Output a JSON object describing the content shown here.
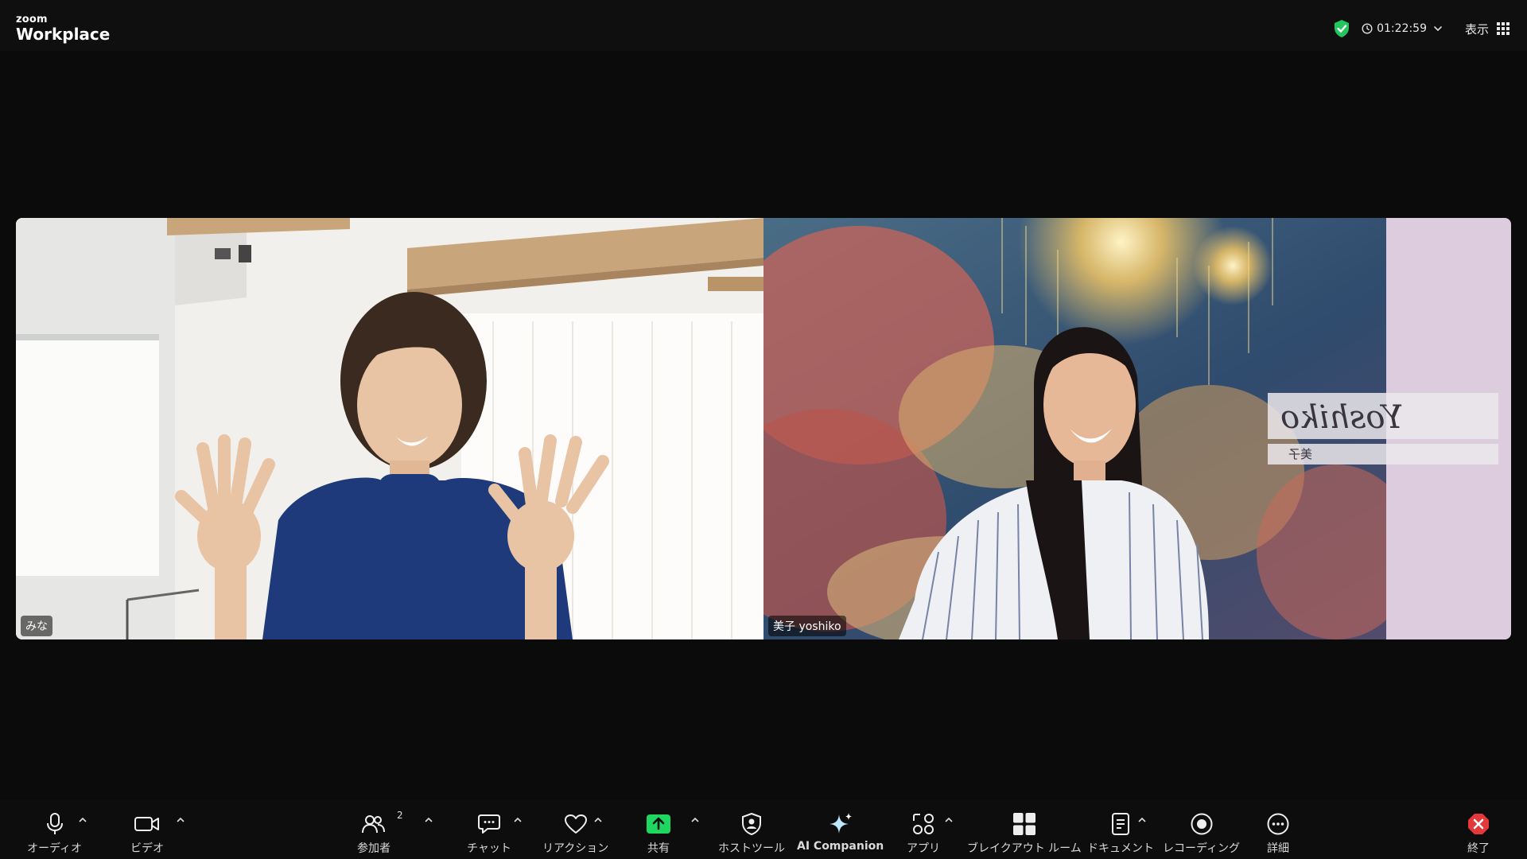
{
  "app": {
    "brand_small": "zoom",
    "brand_large": "Workplace"
  },
  "header": {
    "timer": "01:22:59",
    "view_label": "表示",
    "icons": [
      "shield-check-icon",
      "clock-icon",
      "chevron-down-icon",
      "grid-icon"
    ]
  },
  "participants": [
    {
      "name": "みな"
    },
    {
      "name": "美子 yoshiko",
      "background_signature": "Yoshiko",
      "background_subtitle": "美子"
    }
  ],
  "toolbar": {
    "audio": "オーディオ",
    "video": "ビデオ",
    "participants": "参加者",
    "participants_count": "2",
    "chat": "チャット",
    "reactions": "リアクション",
    "share": "共有",
    "host_tools": "ホストツール",
    "ai_companion": "AI Companion",
    "apps": "アプリ",
    "breakout": "ブレイクアウト ルーム",
    "docs": "ドキュメント",
    "recording": "レコーディング",
    "more": "詳細",
    "end": "終了"
  },
  "colors": {
    "share_green": "#1ed760",
    "shield_green": "#22c55e",
    "end_red": "#e5383b"
  }
}
